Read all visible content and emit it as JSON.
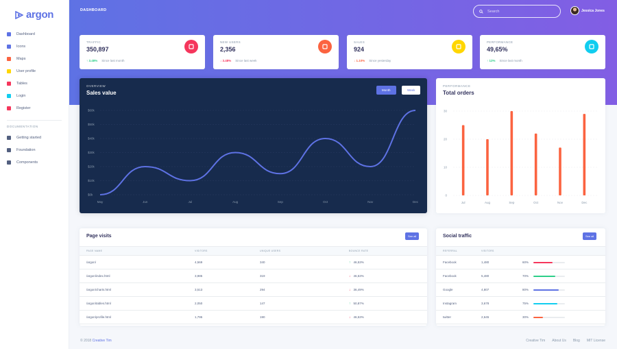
{
  "brand": {
    "name": "argon",
    "color": "#5e72e4"
  },
  "sidebar": {
    "items": [
      {
        "label": "Dashboard",
        "icon": "tv-icon",
        "color": "#5e72e4"
      },
      {
        "label": "Icons",
        "icon": "planet-icon",
        "color": "#5e72e4"
      },
      {
        "label": "Maps",
        "icon": "pin-icon",
        "color": "#fb6340"
      },
      {
        "label": "User profile",
        "icon": "user-icon",
        "color": "#ffd600"
      },
      {
        "label": "Tables",
        "icon": "bullet-list-icon",
        "color": "#f5365c"
      },
      {
        "label": "Login",
        "icon": "key-icon",
        "color": "#11cdef"
      },
      {
        "label": "Register",
        "icon": "circle-icon",
        "color": "#f5365c"
      }
    ],
    "section_heading": "Documentation",
    "doc_items": [
      {
        "label": "Getting started",
        "icon": "spaceship-icon"
      },
      {
        "label": "Foundation",
        "icon": "palette-icon"
      },
      {
        "label": "Components",
        "icon": "ui-icon"
      }
    ]
  },
  "header": {
    "title": "DASHBOARD",
    "search_placeholder": "Search",
    "user_name": "Jessica Jones"
  },
  "stats": [
    {
      "label": "Traffic",
      "value": "350,897",
      "change": "3.48%",
      "direction": "up",
      "note": "Since last month",
      "icon": "chart-bar-icon",
      "icon_color": "#f5365c",
      "change_color": "#2dce89"
    },
    {
      "label": "New users",
      "value": "2,356",
      "change": "3.48%",
      "direction": "down",
      "note": "Since last week",
      "icon": "chart-pie-icon",
      "icon_color": "#fb6340",
      "change_color": "#f5365c"
    },
    {
      "label": "Sales",
      "value": "924",
      "change": "1.10%",
      "direction": "down",
      "note": "Since yesterday",
      "icon": "users-icon",
      "icon_color": "#ffd600",
      "change_color": "#fb6340"
    },
    {
      "label": "Performance",
      "value": "49,65%",
      "change": "12%",
      "direction": "up",
      "note": "Since last month",
      "icon": "percent-icon",
      "icon_color": "#11cdef",
      "change_color": "#2dce89"
    }
  ],
  "sales_card": {
    "subtitle": "Overview",
    "title": "Sales value",
    "tab_month": "Month",
    "tab_week": "Week",
    "line_color": "#5e72e4"
  },
  "orders_card": {
    "subtitle": "Performance",
    "title": "Total orders",
    "bar_color": "#fb6340"
  },
  "chart_data": [
    {
      "type": "line",
      "title": "Sales value",
      "categories": [
        "May",
        "Jun",
        "Jul",
        "Aug",
        "Sep",
        "Oct",
        "Nov",
        "Dec"
      ],
      "series": [
        {
          "values": [
            0,
            20,
            10,
            30,
            15,
            40,
            20,
            60
          ]
        }
      ],
      "y_ticks": [
        "$0k",
        "$10k",
        "$20k",
        "$30k",
        "$40k",
        "$50k",
        "$60k"
      ],
      "ylim": [
        0,
        60
      ],
      "grid": true
    },
    {
      "type": "bar",
      "title": "Total orders",
      "categories": [
        "Jul",
        "Aug",
        "Sep",
        "Oct",
        "Nov",
        "Dec"
      ],
      "values": [
        25,
        20,
        30,
        22,
        17,
        29
      ],
      "y_ticks": [
        "0",
        "10",
        "20",
        "30"
      ],
      "ylim": [
        0,
        30
      ],
      "grid": true
    }
  ],
  "page_visits": {
    "title": "Page visits",
    "see_all": "See all",
    "headers": [
      "Page name",
      "Visitors",
      "Unique users",
      "Bounce rate"
    ],
    "rows": [
      {
        "page": "/argon/",
        "visitors": "4,569",
        "unique": "340",
        "bounce": "46,53%",
        "direction": "up"
      },
      {
        "page": "/argon/index.html",
        "visitors": "3,985",
        "unique": "319",
        "bounce": "46,53%",
        "direction": "down"
      },
      {
        "page": "/argon/charts.html",
        "visitors": "3,513",
        "unique": "294",
        "bounce": "36,49%",
        "direction": "down"
      },
      {
        "page": "/argon/tables.html",
        "visitors": "2,050",
        "unique": "147",
        "bounce": "50,87%",
        "direction": "up"
      },
      {
        "page": "/argon/profile.html",
        "visitors": "1,795",
        "unique": "190",
        "bounce": "46,53%",
        "direction": "down"
      }
    ]
  },
  "social_traffic": {
    "title": "Social traffic",
    "see_all": "See all",
    "headers": [
      "Referral",
      "Visitors",
      ""
    ],
    "rows": [
      {
        "referral": "Facebook",
        "visitors": "1,480",
        "percent": "60%",
        "fraction": 0.6,
        "color": "#f5365c"
      },
      {
        "referral": "Facebook",
        "visitors": "5,480",
        "percent": "70%",
        "fraction": 0.7,
        "color": "#2dce89"
      },
      {
        "referral": "Google",
        "visitors": "4,807",
        "percent": "80%",
        "fraction": 0.8,
        "color": "#5e72e4"
      },
      {
        "referral": "Instagram",
        "visitors": "3,678",
        "percent": "75%",
        "fraction": 0.75,
        "color": "#11cdef"
      },
      {
        "referral": "twitter",
        "visitors": "2,645",
        "percent": "30%",
        "fraction": 0.3,
        "color": "#fb6340"
      }
    ]
  },
  "footer": {
    "copyright": "© 2018",
    "company": "Creative Tim",
    "links": [
      "Creative Tim",
      "About Us",
      "Blog",
      "MIT License"
    ]
  }
}
